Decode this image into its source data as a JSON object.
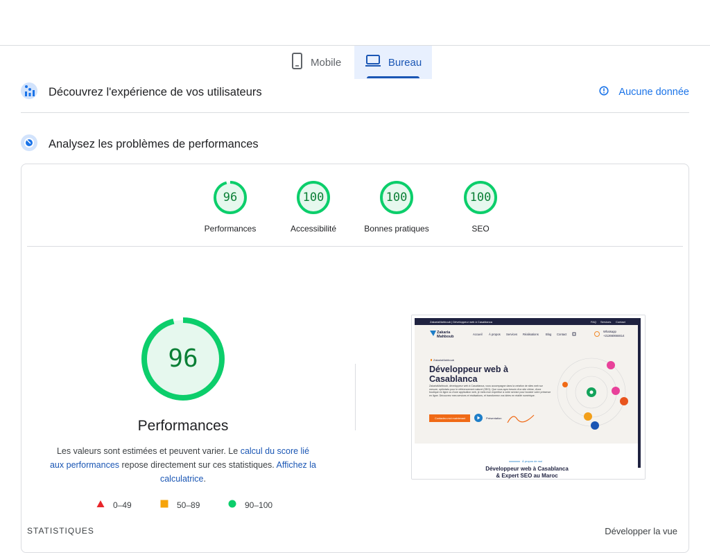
{
  "tabs": {
    "mobile_label": "Mobile",
    "bureau_label": "Bureau",
    "mobile_icon": "smartphone-icon",
    "bureau_icon": "laptop-icon"
  },
  "crux": {
    "title": "Découvrez l'expérience de vos utilisateurs",
    "icon": "users-chart-icon",
    "no_data_icon": "info-icon",
    "no_data_label": "Aucune donnée"
  },
  "lighthouse": {
    "title": "Analysez les problèmes de performances",
    "icon": "lighthouse-icon"
  },
  "categories": [
    {
      "label": "Performances",
      "score": "96",
      "fraction": 0.96
    },
    {
      "label": "Accessibilité",
      "score": "100",
      "fraction": 1.0
    },
    {
      "label": "Bonnes pratiques",
      "score": "100",
      "fraction": 1.0
    },
    {
      "label": "SEO",
      "score": "100",
      "fraction": 1.0
    }
  ],
  "performance": {
    "score": "96",
    "fraction": 0.96,
    "title": "Performances",
    "desc_1": "Les valeurs sont estimées et peuvent varier. Le ",
    "link_1": "calcul du score lié aux performances",
    "desc_2": " repose directement sur ces statistiques. ",
    "link_2": "Affichez la calculatrice",
    "desc_3": "."
  },
  "legend": [
    {
      "label": "0–49",
      "color": "#e8262b",
      "shape": "triangle"
    },
    {
      "label": "50–89",
      "color": "#f6a30a",
      "shape": "square"
    },
    {
      "label": "90–100",
      "color": "#0cce6b",
      "shape": "circle"
    }
  ],
  "screenshot": {
    "topbar_text": "ZakariaMahboub | Développeur web à Casablanca",
    "topbar_links": [
      "FAQ",
      "Services",
      "Contact"
    ],
    "brand_line1": "Zakaria",
    "brand_line2": "Mahboub",
    "nav": [
      "Accueil",
      "À propos",
      "Services",
      "Réalisations",
      "Blog",
      "Contact"
    ],
    "whatsapp_label": "Whatsapp",
    "whatsapp_number": "+212660684614",
    "kicker": "ZakariaMahboub",
    "hero_line1": "Développeur web à",
    "hero_line2": "Casablanca",
    "hero_text": "ZakariaMahboub, développeur web à Casablanca, vous accompagne dans la création de sites web sur mesure, optimisés pour le référencement naturel (SEO). Que vous ayez besoin d'un site vitrine, d'une boutique en ligne ou d'une application web, je mets mon expertise à votre service pour booster votre présence en ligne. Découvrez mes services et réalisations, et transformez vos idées en réalité numérique.",
    "cta_label": "Contactez-moi maintenant",
    "play_label": "Présentation",
    "section_kicker": "À propos de moi",
    "section_line1": "Développeur web à Casablanca",
    "section_line2": "& Expert SEO au Maroc"
  },
  "stats": {
    "title": "STATISTIQUES",
    "expand_label": "Développer la vue"
  },
  "colors": {
    "accent": "#1a56b4",
    "link": "#1a73e8",
    "pass": "#0cce6b",
    "pass_text": "#0a7f35",
    "pass_fill": "#e6f8ee"
  }
}
